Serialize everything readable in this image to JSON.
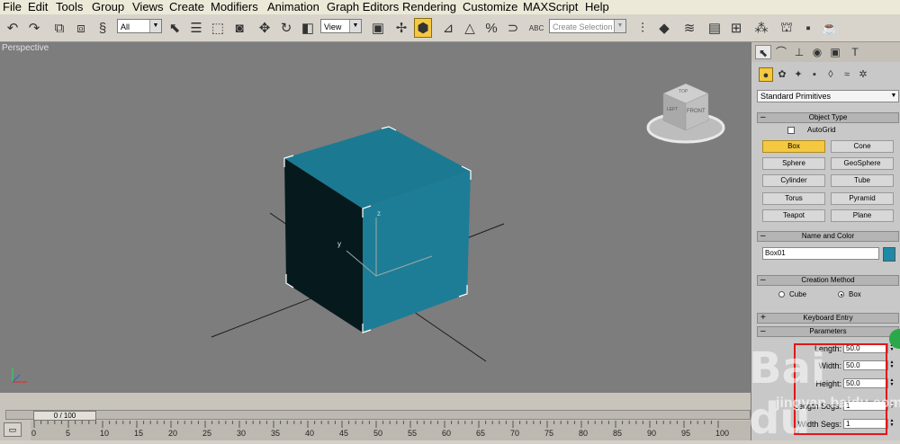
{
  "menu": [
    "File",
    "Edit",
    "Tools",
    "Group",
    "Views",
    "Create",
    "Modifiers",
    "Animation",
    "Graph Editors",
    "Rendering",
    "Customize",
    "MAXScript",
    "Help"
  ],
  "toolbar": {
    "filter_value": "All",
    "refcoord_value": "View",
    "selection_set_placeholder": "Create Selection Se",
    "abc_label": "ABC"
  },
  "viewport": {
    "label": "Perspective",
    "box_color": "#1e7d96",
    "viewcube_top": "TOP",
    "viewcube_front": "FRONT",
    "viewcube_left": "LEFT",
    "gizmo_z": "z",
    "gizmo_y": "y"
  },
  "timeline": {
    "frame_readout": "0 / 100",
    "ticks": [
      "0",
      "5",
      "10",
      "15",
      "20",
      "25",
      "30",
      "35",
      "40",
      "45",
      "50",
      "55",
      "60",
      "65",
      "70",
      "75",
      "80",
      "85",
      "90",
      "95",
      "100"
    ]
  },
  "panel": {
    "category_dropdown": "Standard Primitives",
    "object_type": {
      "title": "Object Type",
      "autogrid": "AutoGrid",
      "buttons": [
        "Box",
        "Cone",
        "Sphere",
        "GeoSphere",
        "Cylinder",
        "Tube",
        "Torus",
        "Pyramid",
        "Teapot",
        "Plane"
      ]
    },
    "name_color": {
      "title": "Name and Color",
      "name_value": "Box01",
      "color": "#1e8aa7"
    },
    "creation_method": {
      "title": "Creation Method",
      "cube": "Cube",
      "box": "Box"
    },
    "keyboard_entry": {
      "title": "Keyboard Entry"
    },
    "parameters": {
      "title": "Parameters",
      "length_label": "Length:",
      "length_value": "50.0",
      "width_label": "Width:",
      "width_value": "50.0",
      "height_label": "Height:",
      "height_value": "50.0",
      "lsegs_label": "Length Segs:",
      "lsegs_value": "1",
      "wsegs_label": "Width Segs:",
      "wsegs_value": "1"
    }
  },
  "watermark": {
    "logo": "Bai du",
    "sub": "jingyan.baidu.com"
  }
}
